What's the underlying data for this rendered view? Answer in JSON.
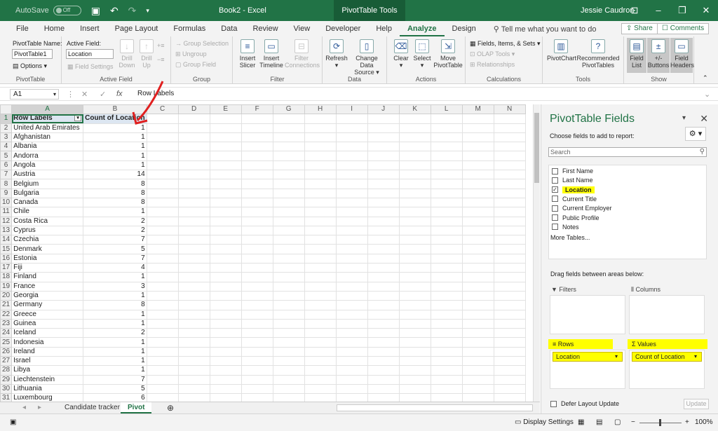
{
  "titlebar": {
    "autosave_label": "AutoSave",
    "autosave_state": "Off",
    "doc_title": "Book2 - Excel",
    "context_tools": "PivotTable Tools",
    "user": "Jessie Caudron"
  },
  "tabs": [
    "File",
    "Home",
    "Insert",
    "Page Layout",
    "Formulas",
    "Data",
    "Review",
    "View",
    "Developer",
    "Help",
    "Analyze",
    "Design"
  ],
  "active_tab": "Analyze",
  "tell_me": "Tell me what you want to do",
  "share_label": "Share",
  "comments_label": "Comments",
  "ribbon": {
    "pivottable": {
      "name_label": "PivotTable Name:",
      "name_value": "PivotTable1",
      "options": "Options",
      "group": "PivotTable"
    },
    "active_field": {
      "label": "Active Field:",
      "value": "Location",
      "field_settings": "Field Settings",
      "drill_down": "Drill Down",
      "drill_up": "Drill Up",
      "group": "Active Field"
    },
    "group": {
      "group_selection": "Group Selection",
      "ungroup": "Ungroup",
      "group_field": "Group Field",
      "group": "Group"
    },
    "filter": {
      "insert_slicer": "Insert Slicer",
      "insert_timeline": "Insert Timeline",
      "filter_connections": "Filter Connections",
      "group": "Filter"
    },
    "data": {
      "refresh": "Refresh",
      "change_source": "Change Data Source",
      "group": "Data"
    },
    "actions": {
      "clear": "Clear",
      "select": "Select",
      "move": "Move PivotTable",
      "group": "Actions"
    },
    "calculations": {
      "fields_items": "Fields, Items, & Sets",
      "olap": "OLAP Tools",
      "relationships": "Relationships",
      "group": "Calculations"
    },
    "tools": {
      "pivotchart": "PivotChart",
      "recommended": "Recommended PivotTables",
      "group": "Tools"
    },
    "show": {
      "field_list": "Field List",
      "buttons": "+/- Buttons",
      "headers": "Field Headers",
      "group": "Show"
    }
  },
  "formula_bar": {
    "cell": "A1",
    "content": "Row Labels"
  },
  "columns": [
    "A",
    "B",
    "C",
    "D",
    "E",
    "F",
    "G",
    "H",
    "I",
    "J",
    "K",
    "L",
    "M",
    "N"
  ],
  "pivot": {
    "header_rows": "Row Labels",
    "header_count": "Count of Location",
    "rows": [
      [
        "United Arab Emirates",
        "1"
      ],
      [
        "Afghanistan",
        "1"
      ],
      [
        "Albania",
        "1"
      ],
      [
        "Andorra",
        "1"
      ],
      [
        "Angola",
        "1"
      ],
      [
        "Austria",
        "14"
      ],
      [
        "Belgium",
        "8"
      ],
      [
        "Bulgaria",
        "8"
      ],
      [
        "Canada",
        "8"
      ],
      [
        "Chile",
        "1"
      ],
      [
        "Costa Rica",
        "2"
      ],
      [
        "Cyprus",
        "2"
      ],
      [
        "Czechia",
        "7"
      ],
      [
        "Denmark",
        "5"
      ],
      [
        "Estonia",
        "7"
      ],
      [
        "Fiji",
        "4"
      ],
      [
        "Finland",
        "1"
      ],
      [
        "France",
        "3"
      ],
      [
        "Georgia",
        "1"
      ],
      [
        "Germany",
        "8"
      ],
      [
        "Greece",
        "1"
      ],
      [
        "Guinea",
        "1"
      ],
      [
        "Iceland",
        "2"
      ],
      [
        "Indonesia",
        "1"
      ],
      [
        "Ireland",
        "1"
      ],
      [
        "Israel",
        "1"
      ],
      [
        "Libya",
        "1"
      ],
      [
        "Liechtenstein",
        "7"
      ],
      [
        "Lithuania",
        "5"
      ],
      [
        "Luxembourg",
        "6"
      ]
    ]
  },
  "sheet_tabs": [
    "Candidate tracker",
    "Pivot"
  ],
  "active_sheet": "Pivot",
  "status": {
    "display_settings": "Display Settings",
    "zoom": "100%"
  },
  "pane": {
    "title": "PivotTable Fields",
    "subtitle": "Choose fields to add to report:",
    "search_placeholder": "Search",
    "fields": [
      {
        "name": "First Name",
        "checked": false
      },
      {
        "name": "Last Name",
        "checked": false
      },
      {
        "name": "Location",
        "checked": true
      },
      {
        "name": "Current Title",
        "checked": false
      },
      {
        "name": "Current Employer",
        "checked": false
      },
      {
        "name": "Public Profile",
        "checked": false
      },
      {
        "name": "Notes",
        "checked": false
      }
    ],
    "more_tables": "More Tables...",
    "drag_text": "Drag fields between areas below:",
    "areas": {
      "filters": "Filters",
      "columns": "Columns",
      "rows": "Rows",
      "values": "Values"
    },
    "rows_field": "Location",
    "values_field": "Count of Location",
    "defer": "Defer Layout Update",
    "update": "Update"
  },
  "colors": {
    "excel_green": "#217346",
    "highlight": "#ffff00",
    "arrow": "#e02020"
  }
}
